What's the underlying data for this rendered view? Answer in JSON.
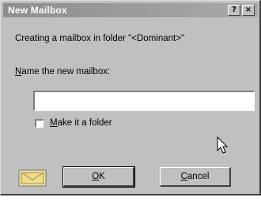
{
  "dialog": {
    "title": "New Mailbox",
    "help_glyph": "?",
    "close_glyph": "×",
    "message": "Creating a mailbox in folder \"<Dominant>\"",
    "name_label_mnemonic": "N",
    "name_label_rest": "ame the new mailbox:",
    "name_value": "",
    "checkbox_checked": false,
    "checkbox_label_mnemonic": "M",
    "checkbox_label_rest": "ake it a folder",
    "ok_label_mnemonic": "O",
    "ok_label_rest": "K",
    "cancel_label_mnemonic": "C",
    "cancel_label_rest": "ancel"
  },
  "icons": {
    "help": "help-icon",
    "close": "close-icon",
    "mailbox": "mailbox-icon",
    "cursor": "mouse-pointer-icon"
  },
  "colors": {
    "face": "#c0c0c0",
    "titlebar": "#8e8e8e",
    "icon": "#f5e7a8"
  }
}
